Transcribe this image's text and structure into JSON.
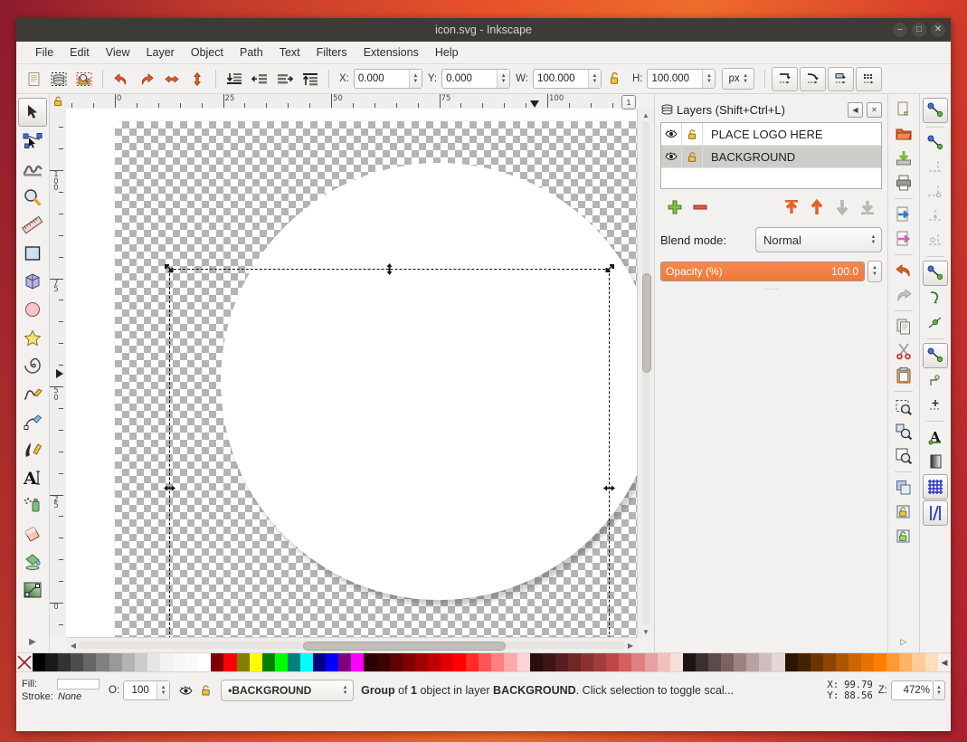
{
  "window": {
    "title": "icon.svg - Inkscape",
    "buttons": [
      {
        "name": "minimize",
        "glyph": "–"
      },
      {
        "name": "maximize",
        "glyph": "□"
      },
      {
        "name": "close",
        "glyph": "✕"
      }
    ]
  },
  "menubar": [
    "File",
    "Edit",
    "View",
    "Layer",
    "Object",
    "Path",
    "Text",
    "Filters",
    "Extensions",
    "Help"
  ],
  "command_toolbar": {
    "icons": [
      "new-document-icon",
      "duplicate-icon",
      "zoom-document-icon",
      "undo-icon",
      "redo-icon",
      "flip-horizontal-icon",
      "flip-vertical-icon",
      "lower-to-bottom-icon",
      "lower-icon",
      "raise-icon",
      "raise-to-top-icon"
    ],
    "fields": [
      {
        "label": "X:",
        "value": "0.000",
        "name": "x-field"
      },
      {
        "label": "Y:",
        "value": "0.000",
        "name": "y-field"
      },
      {
        "label": "W:",
        "value": "100.000",
        "name": "width-field"
      },
      {
        "label": "H:",
        "value": "100.000",
        "name": "height-field"
      }
    ],
    "lock_icon": "lock-open-icon",
    "units": "px",
    "right_buttons": [
      "affect-transforms-icon",
      "affect-rounded-corners-icon",
      "affect-gradients-icon",
      "affect-patterns-icon"
    ]
  },
  "toolbox": [
    {
      "name": "selector-tool",
      "selected": true
    },
    {
      "name": "node-tool",
      "selected": false
    },
    {
      "name": "tweak-tool",
      "selected": false
    },
    {
      "name": "zoom-tool",
      "selected": false
    },
    {
      "name": "measure-tool",
      "selected": false
    },
    {
      "name": "rectangle-tool",
      "selected": false
    },
    {
      "name": "3dbox-tool",
      "selected": false
    },
    {
      "name": "ellipse-tool",
      "selected": false
    },
    {
      "name": "star-tool",
      "selected": false
    },
    {
      "name": "spiral-tool",
      "selected": false
    },
    {
      "name": "pencil-tool",
      "selected": false
    },
    {
      "name": "bezier-tool",
      "selected": false
    },
    {
      "name": "calligraphy-tool",
      "selected": false
    },
    {
      "name": "text-tool",
      "selected": false
    },
    {
      "name": "spray-tool",
      "selected": false
    },
    {
      "name": "eraser-tool",
      "selected": false
    },
    {
      "name": "paintbucket-tool",
      "selected": false
    },
    {
      "name": "gradient-tool",
      "selected": false
    }
  ],
  "rulers": {
    "unit_badge": "1",
    "horizontal_labels": [
      "0",
      "25",
      "50",
      "75",
      "100"
    ],
    "vertical_labels": [
      "100",
      "75",
      "50",
      "25",
      "0"
    ]
  },
  "layers_dialog": {
    "title": "Layers (Shift+Ctrl+L)",
    "collapse_icon": "collapse-icon",
    "close_icon": "close-icon",
    "columns": [
      "visibility",
      "lock",
      "name"
    ],
    "rows": [
      {
        "name": "PLACE LOGO HERE",
        "visible": true,
        "locked": false,
        "selected": false
      },
      {
        "name": "BACKGROUND",
        "visible": true,
        "locked": false,
        "selected": true
      }
    ],
    "buttons": [
      "add-layer-icon",
      "remove-layer-icon",
      "raise-to-top-icon",
      "raise-layer-icon",
      "lower-layer-icon",
      "lower-to-bottom-icon"
    ],
    "blend_label": "Blend mode:",
    "blend_value": "Normal",
    "opacity_label": "Opacity (%)",
    "opacity_value": "100.0",
    "opacity_percent": 100
  },
  "command_column": [
    "new-icon",
    "open-icon",
    "save-icon",
    "print-icon",
    "import-icon",
    "export-icon",
    "undo-icon",
    "redo-icon",
    "copy-icon",
    "cut-icon",
    "paste-icon",
    "zoom-selection-icon",
    "zoom-drawing-icon",
    "zoom-page-icon",
    "duplicate-icon",
    "group-icon",
    "ungroup-icon"
  ],
  "snap_toolbar": [
    {
      "name": "enable-snapping",
      "on": true
    },
    {
      "name": "snap-bounding-boxes",
      "on": false
    },
    {
      "name": "snap-bbox-edges",
      "on": false
    },
    {
      "name": "snap-bbox-corners",
      "on": false
    },
    {
      "name": "snap-bbox-edge-midpoints",
      "on": false
    },
    {
      "name": "snap-bbox-centers",
      "on": false
    },
    {
      "name": "snap-nodes-paths",
      "on": true
    },
    {
      "name": "snap-paths",
      "on": true
    },
    {
      "name": "snap-path-intersections",
      "on": false
    },
    {
      "name": "snap-to-cusp-nodes",
      "on": false
    },
    {
      "name": "snap-smooth-nodes",
      "on": true
    },
    {
      "name": "snap-midpoints-line-segments",
      "on": false
    },
    {
      "name": "snap-object-centers",
      "on": false
    },
    {
      "name": "snap-text-baselines",
      "on": false
    },
    {
      "name": "snap-page-border",
      "on": false
    },
    {
      "name": "snap-grid",
      "on": true
    },
    {
      "name": "snap-guides",
      "on": true
    }
  ],
  "palette": {
    "none_swatch": "none-swatch",
    "left_arrow": "◀",
    "colors": [
      "#000000",
      "#1a1a1a",
      "#333333",
      "#4d4d4d",
      "#666666",
      "#808080",
      "#999999",
      "#b3b3b3",
      "#cccccc",
      "#e6e6e6",
      "#f2f2f2",
      "#f7f7f7",
      "#fafafa",
      "#ffffff",
      "#800000",
      "#ff0000",
      "#808000",
      "#ffff00",
      "#008000",
      "#00ff00",
      "#008080",
      "#00ffff",
      "#000080",
      "#0000ff",
      "#800080",
      "#ff00ff",
      "#2b0000",
      "#3d0000",
      "#600000",
      "#800000",
      "#a00000",
      "#c00000",
      "#e00000",
      "#ff0000",
      "#ff2b2b",
      "#ff5555",
      "#ff8080",
      "#ffaaaa",
      "#ffd4d4",
      "#2a0d0d",
      "#3d1515",
      "#561f1f",
      "#6e2828",
      "#8a3232",
      "#a33c3c",
      "#bd4747",
      "#d45f5f",
      "#dd8080",
      "#e8a0a0",
      "#f2c0c0",
      "#f9dede",
      "#1c1414",
      "#3b2f2f",
      "#5d4a4a",
      "#7c6262",
      "#9c8282",
      "#b7a1a1",
      "#cfbcbc",
      "#e3d6d6",
      "#2b1400",
      "#452200",
      "#6b3400",
      "#8c4500",
      "#ad5600",
      "#cc6600",
      "#e67300",
      "#ff8000",
      "#ff9933",
      "#ffb366",
      "#ffcc99",
      "#ffdfbb"
    ]
  },
  "status_bar": {
    "fill_label": "Fill:",
    "stroke_label": "Stroke:",
    "stroke_value": "None",
    "opacity_label": "O:",
    "opacity_value": "100",
    "eye_icon": "eye-icon",
    "lock_icon": "lock-icon",
    "layer_value": "•BACKGROUND",
    "message": "Group of 1 object in layer BACKGROUND. Click selection to toggle scal...",
    "message_parts": [
      {
        "text": "Group",
        "bold": true
      },
      {
        "text": " of ",
        "bold": false
      },
      {
        "text": "1",
        "bold": true
      },
      {
        "text": " object in layer ",
        "bold": false
      },
      {
        "text": "BACKGROUND",
        "bold": true
      },
      {
        "text": ". Click selection to toggle scal...",
        "bold": false
      }
    ],
    "cursor_x_label": "X:",
    "cursor_x": "99.79",
    "cursor_y_label": "Y:",
    "cursor_y": "88.56",
    "zoom_label": "Z:",
    "zoom_value": "472%"
  },
  "colors": {
    "accent_orange": "#ef7a3c",
    "desktop": "#e8522a",
    "titlebar": "#3c3b37",
    "chrome": "#f2f1f0"
  }
}
